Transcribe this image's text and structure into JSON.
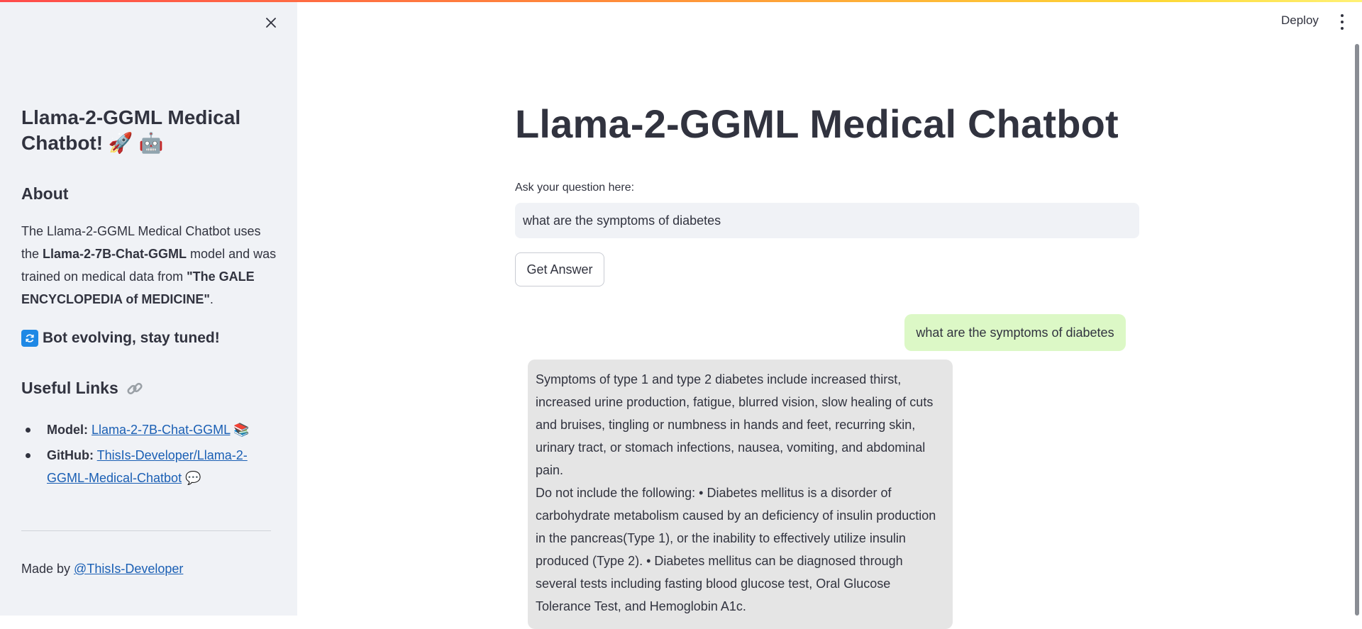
{
  "sidebar": {
    "title": "Llama-2-GGML Medical Chatbot! 🚀 🤖",
    "about_heading": "About",
    "about_text_1": "The Llama-2-GGML Medical Chatbot uses the ",
    "about_model": "Llama-2-7B-Chat-GGML",
    "about_text_2": " model and was trained on medical data from ",
    "about_source": "\"The GALE ENCYCLOPEDIA of MEDICINE\"",
    "about_text_3": ".",
    "evolving": "Bot evolving, stay tuned!",
    "links_heading": "Useful Links",
    "links": [
      {
        "label": "Model:",
        "text": "Llama-2-7B-Chat-GGML",
        "emoji": "📚"
      },
      {
        "label": "GitHub:",
        "text": "ThisIs-Developer/Llama-2-GGML-Medical-Chatbot",
        "emoji": "💬"
      }
    ],
    "made_by_prefix": "Made by ",
    "made_by_link": "@ThisIs-Developer"
  },
  "header": {
    "deploy_label": "Deploy"
  },
  "main": {
    "title": "Llama-2-GGML Medical Chatbot",
    "question_label": "Ask your question here:",
    "question_value": "what are the symptoms of diabetes",
    "button_label": "Get Answer",
    "user_message": "what are the symptoms of diabetes",
    "bot_message_1": "Symptoms of type 1 and type 2 diabetes include increased thirst, increased urine production, fatigue, blurred vision, slow healing of cuts and bruises, tingling or numbness in hands and feet, recurring skin, urinary tract, or stomach infections, nausea, vomiting, and abdominal pain.",
    "bot_message_2": "Do not include the following: • Diabetes mellitus is a disorder of carbohydrate metabolism caused by an deficiency of insulin production in the pancreas(Type 1), or the inability to effectively utilize insulin produced (Type 2). • Diabetes mellitus can be diagnosed through several tests including fasting blood glucose test, Oral Glucose Tolerance Test, and Hemoglobin A1c."
  },
  "colors": {
    "sidebar_bg": "#f0f2f6",
    "user_bubble": "#dcf8c6",
    "bot_bubble": "#e5e5e5",
    "link": "#1a5fb4"
  }
}
